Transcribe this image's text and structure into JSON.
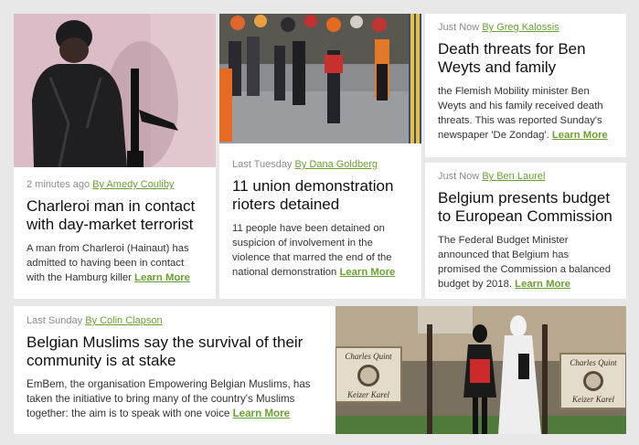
{
  "articles": [
    {
      "time": "2 minutes ago",
      "author": "By Amedy Couliby",
      "title": "Charleroi man in contact with day-market terrorist",
      "excerpt": "A man from Charleroi (Hainaut) has admitted to having been in contact with the Hamburg killer",
      "more": "Learn More"
    },
    {
      "time": "Last Tuesday",
      "author": "By Dana Goldberg",
      "title": "11 union demonstration rioters detained",
      "excerpt": "11 people have been detained on suspicion of involvement in the violence that marred the end of the national demonstration",
      "more": "Learn More"
    },
    {
      "time": "Just Now",
      "author": "By Greg Kalossis",
      "title": "Death threats  for Ben Weyts and family",
      "excerpt": "the Flemish Mobility minister Ben Weyts and his family received death threats. This was reported Sunday's newspaper 'De Zondag'.",
      "more": "Learn More"
    },
    {
      "time": "Just Now",
      "author": "By Ben Laurel",
      "title": "Belgium presents budget to European Commission",
      "excerpt": "The Federal Budget Minister announced that Belgium has promised the Commission a balanced budget by 2018.",
      "more": "Learn More"
    },
    {
      "time": "Last Sunday",
      "author": "By Colin Clapson",
      "title": "Belgian Muslims say the survival of their community is at stake",
      "excerpt": "EmBem, the organisation Empowering Belgian Muslims, has taken the initiative to bring many of the country's Muslims together: the aim is to speak with one voice",
      "more": "Learn More"
    }
  ],
  "photos": {
    "sign_line1": "Charles Quint",
    "sign_line2": "Keizer Karel"
  },
  "colors": {
    "accent": "#6aa032",
    "background": "#e8e8e8"
  }
}
